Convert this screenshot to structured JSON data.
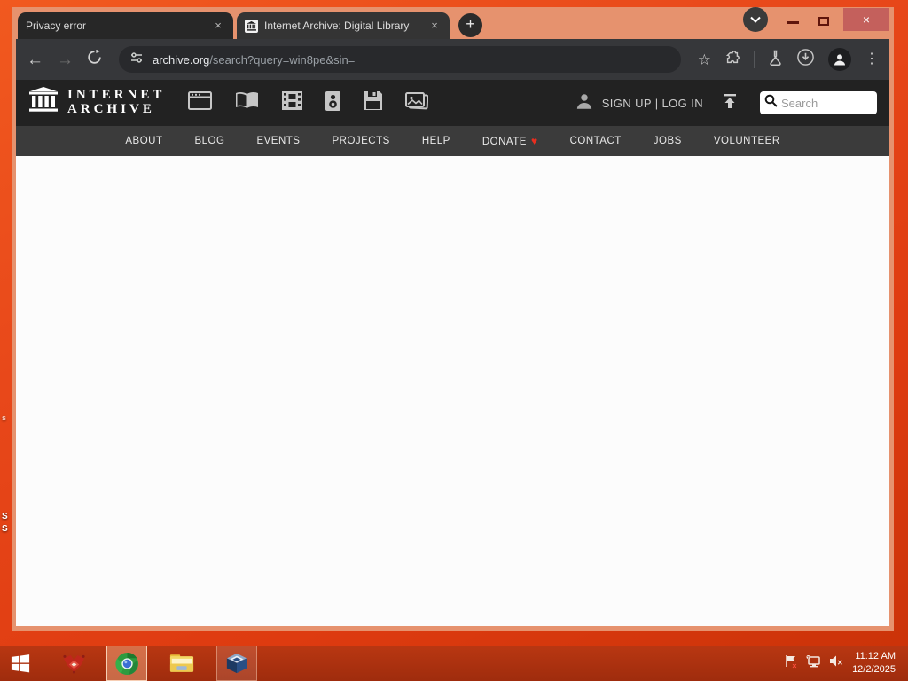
{
  "browser": {
    "tabs": [
      {
        "title": "Privacy error"
      },
      {
        "title": "Internet Archive: Digital Library"
      }
    ],
    "address": "archive.org/search?query=win8pe&sin=",
    "address_domain": "archive.org",
    "address_path": "/search?query=win8pe&sin="
  },
  "archive": {
    "logo_line1": "INTERNET",
    "logo_line2": "ARCHIVE",
    "auth": "SIGN UP | LOG IN",
    "search_placeholder": "Search",
    "nav_items": [
      "ABOUT",
      "BLOG",
      "EVENTS",
      "PROJECTS",
      "HELP",
      "DONATE",
      "CONTACT",
      "JOBS",
      "VOLUNTEER"
    ]
  },
  "taskbar": {
    "time": "11:12 AM",
    "date": "12/2/2025"
  },
  "desktop": {
    "label_fragments": [
      "s",
      "S",
      "S"
    ]
  },
  "icons": {
    "new_tab_plus": "+",
    "tab_close": "×",
    "window_close": "×",
    "back_arrow": "←",
    "forward_arrow": "→",
    "bookmark_star": "☆",
    "menu_kebab": "⋮",
    "donate_heart": "♥"
  },
  "colors": {
    "titlebar": "#e6926e",
    "toolbar": "#36373a",
    "ia_header": "#222222",
    "ia_nav": "#3b3b3b",
    "desktop_orange": "#e8481a",
    "taskbar_red": "#a52c0e",
    "donate_heart": "#e82e1f",
    "close_button": "#c4605c"
  }
}
